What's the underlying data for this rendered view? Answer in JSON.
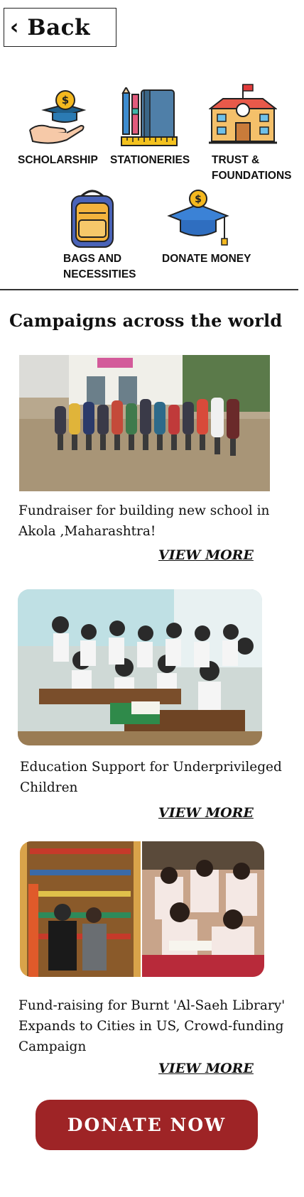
{
  "header": {
    "back_label": "Back"
  },
  "categories": [
    {
      "label_line1": "SCHOLARSHIP",
      "label_line2": "",
      "icon": "scholarship-hand-icon"
    },
    {
      "label_line1": "STATIONERIES",
      "label_line2": "",
      "icon": "stationery-icon"
    },
    {
      "label_line1": "TRUST &",
      "label_line2": "FOUNDATIONS",
      "icon": "school-building-icon"
    },
    {
      "label_line1": "BAGS AND",
      "label_line2": "NECESSITIES",
      "icon": "backpack-icon"
    },
    {
      "label_line1": "DONATE MONEY",
      "label_line2": "",
      "icon": "graduation-cap-coin-icon"
    }
  ],
  "section": {
    "title": "Campaigns across the world"
  },
  "campaigns": [
    {
      "title_line1": "Fundraiser for building new school in",
      "title_line2": "Akola ,Maharashtra!",
      "title_line3": "",
      "cta": "VIEW MORE",
      "image": "group-of-children-outside-school-photo"
    },
    {
      "title_line1": "Education Support for Underprivileged",
      "title_line2": "Children",
      "title_line3": "",
      "cta": "VIEW MORE",
      "image": "students-in-classroom-photo"
    },
    {
      "title_line1": "Fund-raising for Burnt 'Al-Saeh Library'",
      "title_line2": "Expands to Cities in US, Crowd-funding",
      "title_line3": "Campaign",
      "cta": "VIEW MORE",
      "image": "library-and-children-collage-photo"
    }
  ],
  "footer": {
    "donate_label": "DONATE  NOW"
  },
  "colors": {
    "donate_button": "#9e2426",
    "text": "#111111",
    "divider": "#333333"
  }
}
